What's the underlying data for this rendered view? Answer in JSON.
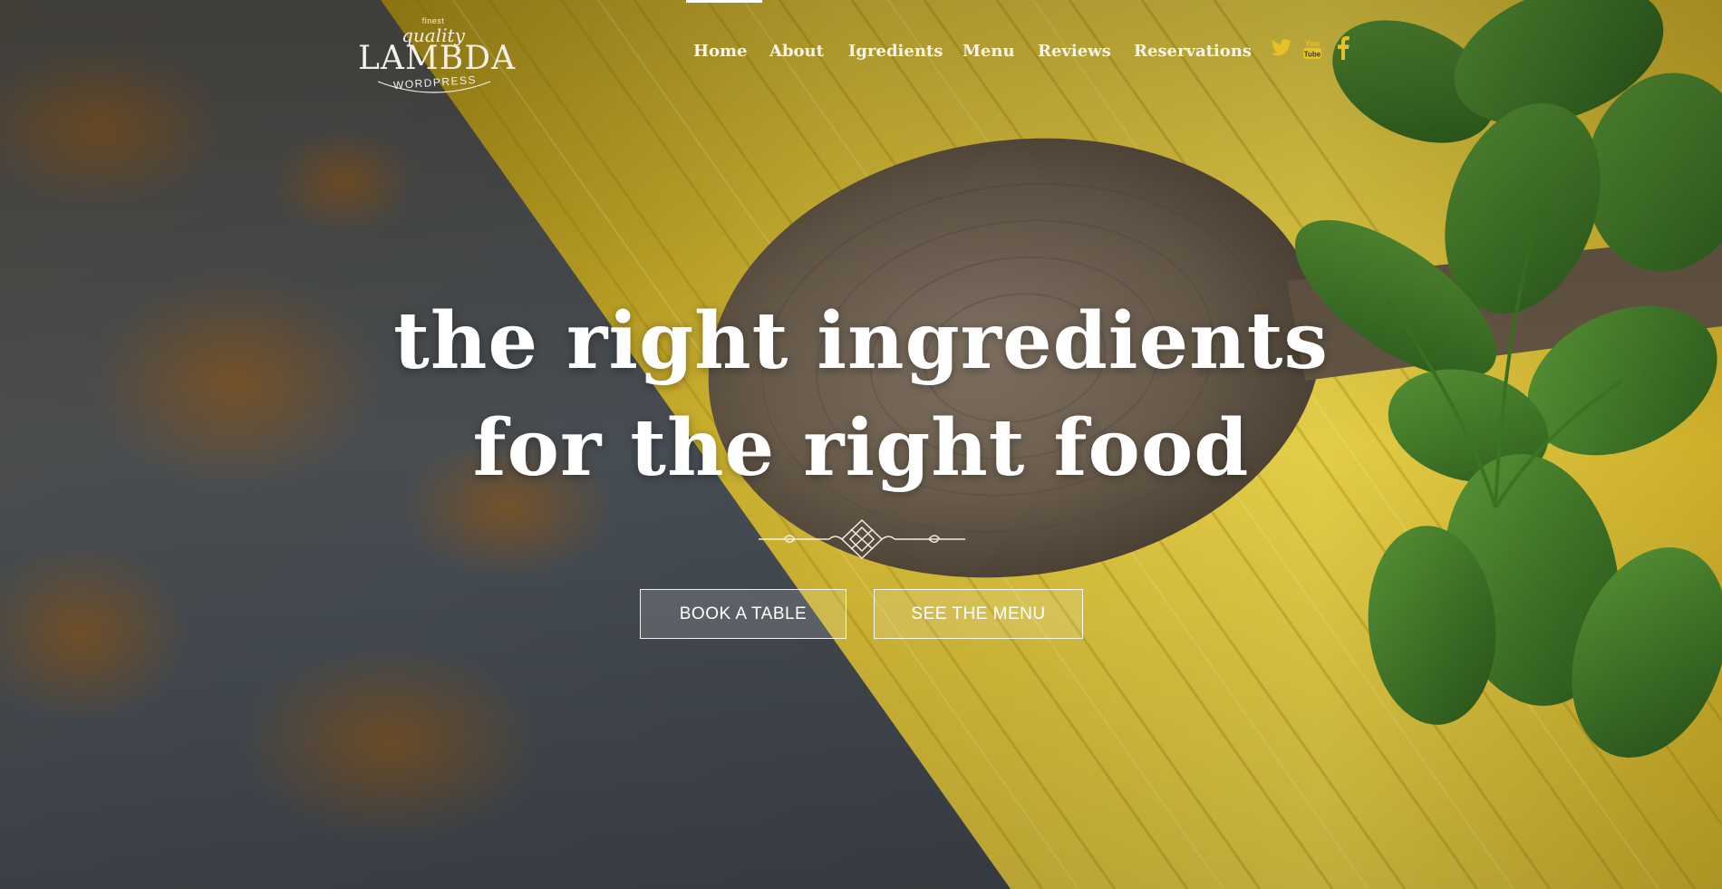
{
  "logo": {
    "finest": "finest",
    "quality": "quality",
    "brand": "LAMBDA",
    "sub": "WORDPRESS"
  },
  "nav": {
    "items": [
      {
        "label": "Home",
        "active": true
      },
      {
        "label": "About"
      },
      {
        "label": "Igredients"
      },
      {
        "label": "Menu"
      },
      {
        "label": "Reviews"
      },
      {
        "label": "Reservations"
      }
    ]
  },
  "social": [
    {
      "icon": "twitter-icon"
    },
    {
      "icon": "youtube-icon",
      "text": "You Tube"
    },
    {
      "icon": "facebook-icon",
      "text": "f"
    }
  ],
  "hero": {
    "line1": "the right ingredients",
    "line2": "for the right food"
  },
  "buttons": {
    "book": "BOOK A TABLE",
    "menu": "SEE THE MENU"
  },
  "colors": {
    "accent": "#e6c12a",
    "text": "#ffffff"
  }
}
